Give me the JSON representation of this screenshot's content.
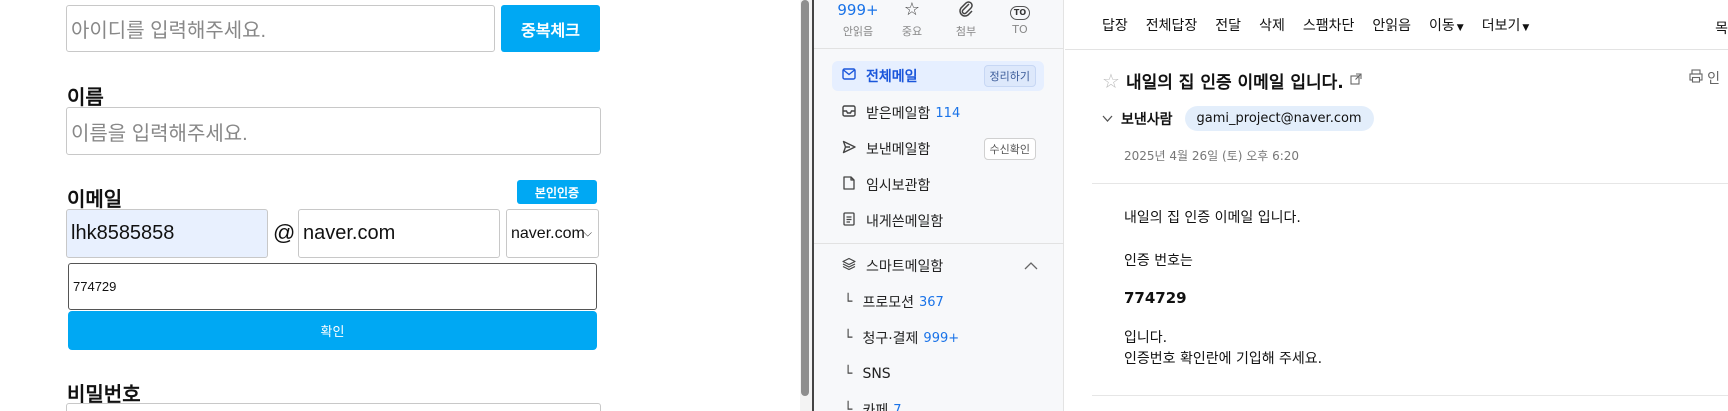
{
  "form": {
    "id_placeholder": "아이디를 입력해주세요.",
    "dup_check_label": "중복체크",
    "name_label": "이름",
    "name_placeholder": "이름을 입력해주세요.",
    "email_label": "이메일",
    "verify_button_label": "본인인증",
    "email_local": "lhk8585858",
    "at_symbol": "@",
    "email_domain": "naver.com",
    "domain_select_value": "naver.com",
    "code_value": "774729",
    "confirm_label": "확인",
    "password_label": "비밀번호"
  },
  "sidebar": {
    "quick": [
      {
        "icon": "unread-icon",
        "count": "999+",
        "label": "안읽음"
      },
      {
        "icon": "star-icon",
        "label": "중요"
      },
      {
        "icon": "attachment-icon",
        "label": "첨부"
      },
      {
        "icon": "to-icon",
        "badge": "TO",
        "label": "TO"
      }
    ],
    "items": [
      {
        "label": "전체메일",
        "pill": "정리하기",
        "icon": "mail-icon"
      },
      {
        "label": "받은메일함",
        "count": "114",
        "icon": "inbox-icon"
      },
      {
        "label": "보낸메일함",
        "pill": "수신확인",
        "icon": "send-icon"
      },
      {
        "label": "임시보관함",
        "icon": "draft-icon"
      },
      {
        "label": "내게쓴메일함",
        "icon": "note-icon"
      }
    ],
    "smart": {
      "label": "스마트메일함",
      "icon": "layers-icon"
    },
    "sub_items": [
      {
        "label": "프로모션",
        "count": "367"
      },
      {
        "label": "청구·결제",
        "count": "999+"
      },
      {
        "label": "SNS",
        "count": ""
      },
      {
        "label": "카페",
        "count": "7"
      }
    ]
  },
  "viewer": {
    "toolbar": [
      "답장",
      "전체답장",
      "전달",
      "삭제",
      "스팸차단",
      "안읽음",
      "이동",
      "더보기"
    ],
    "toolbar_right_cut": "목",
    "subject": "내일의 집 인증 이메일 입니다.",
    "sender_label": "보낸사람",
    "sender_email": "gami_project@naver.com",
    "date": "2025년 4월 26일 (토) 오후 6:20",
    "body": {
      "line1": "내일의 집 인증 이메일 입니다.",
      "line2": "인증 번호는",
      "code": "774729",
      "line3": "입니다.",
      "line4": "인증번호 확인란에 기입해 주세요."
    },
    "print_cut": "인"
  }
}
